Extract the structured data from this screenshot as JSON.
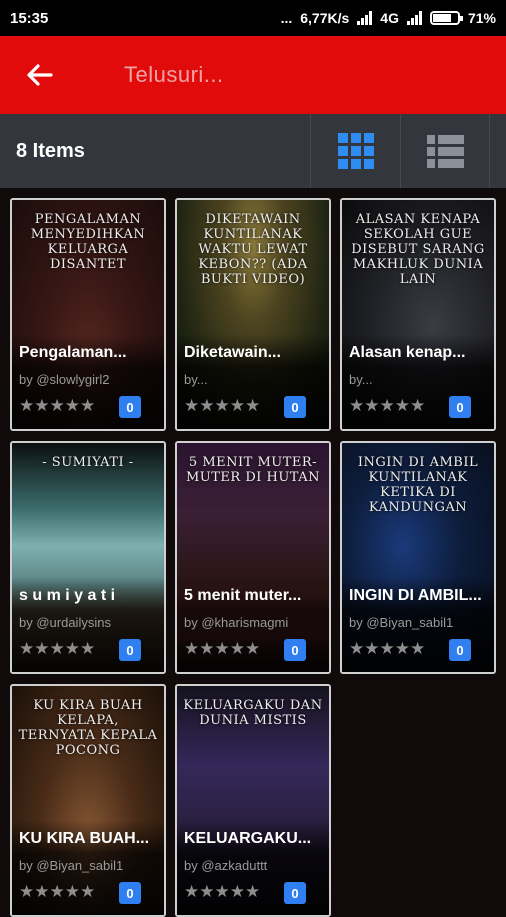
{
  "status_bar": {
    "time": "15:35",
    "dots": "...",
    "speed": "6,77K/s",
    "network": "4G",
    "battery": "71%"
  },
  "app_bar": {
    "back_icon": "arrow-left-icon",
    "search_placeholder": "Telusuri..."
  },
  "toolbar": {
    "items_count": "8 Items",
    "grid_view_icon": "grid-icon",
    "list_view_icon": "list-icon",
    "active_color": "#2f8cf0"
  },
  "colors": {
    "app_bar": "#e20b0b",
    "toolbar": "#33373d",
    "badge": "#2f7ff0"
  },
  "stories": [
    {
      "cover_text": "Pengalaman menyedihkan keluarga disantet",
      "title": "Pengalaman...",
      "author": "by @slowlygirl2",
      "stars": "★★★★★",
      "votes": "0"
    },
    {
      "cover_text": "Diketawain Kuntilanak waktu lewat kebon?? (ada bukti video)",
      "title": "Diketawain...",
      "author": "by...",
      "stars": "★★★★★",
      "votes": "0"
    },
    {
      "cover_text": "Alasan kenapa sekolah gue disebut sarang makhluk dunia lain",
      "title": "Alasan kenap...",
      "author": "by...",
      "stars": "★★★★★",
      "votes": "0"
    },
    {
      "cover_text": "- Sumiyati -",
      "title": "s u m i y a t i",
      "author": "by @urdailysins",
      "stars": "★★★★★",
      "votes": "0"
    },
    {
      "cover_text": "5 menit muter-muter di hutan",
      "title": "5 menit muter...",
      "author": "by @kharismagmi",
      "stars": "★★★★★",
      "votes": "0"
    },
    {
      "cover_text": "Ingin di ambil kuntilanak ketika di kandungan",
      "title": "INGIN DI AMBIL...",
      "author": "by @Biyan_sabil1",
      "stars": "★★★★★",
      "votes": "0"
    },
    {
      "cover_text": "Ku kira buah kelapa, ternyata kepala pocong",
      "title": "KU KIRA BUAH...",
      "author": "by @Biyan_sabil1",
      "stars": "★★★★★",
      "votes": "0"
    },
    {
      "cover_text": "Keluargaku dan dunia mistis",
      "title": "KELUARGAKU...",
      "author": "by @azkaduttt",
      "stars": "★★★★★",
      "votes": "0"
    }
  ]
}
